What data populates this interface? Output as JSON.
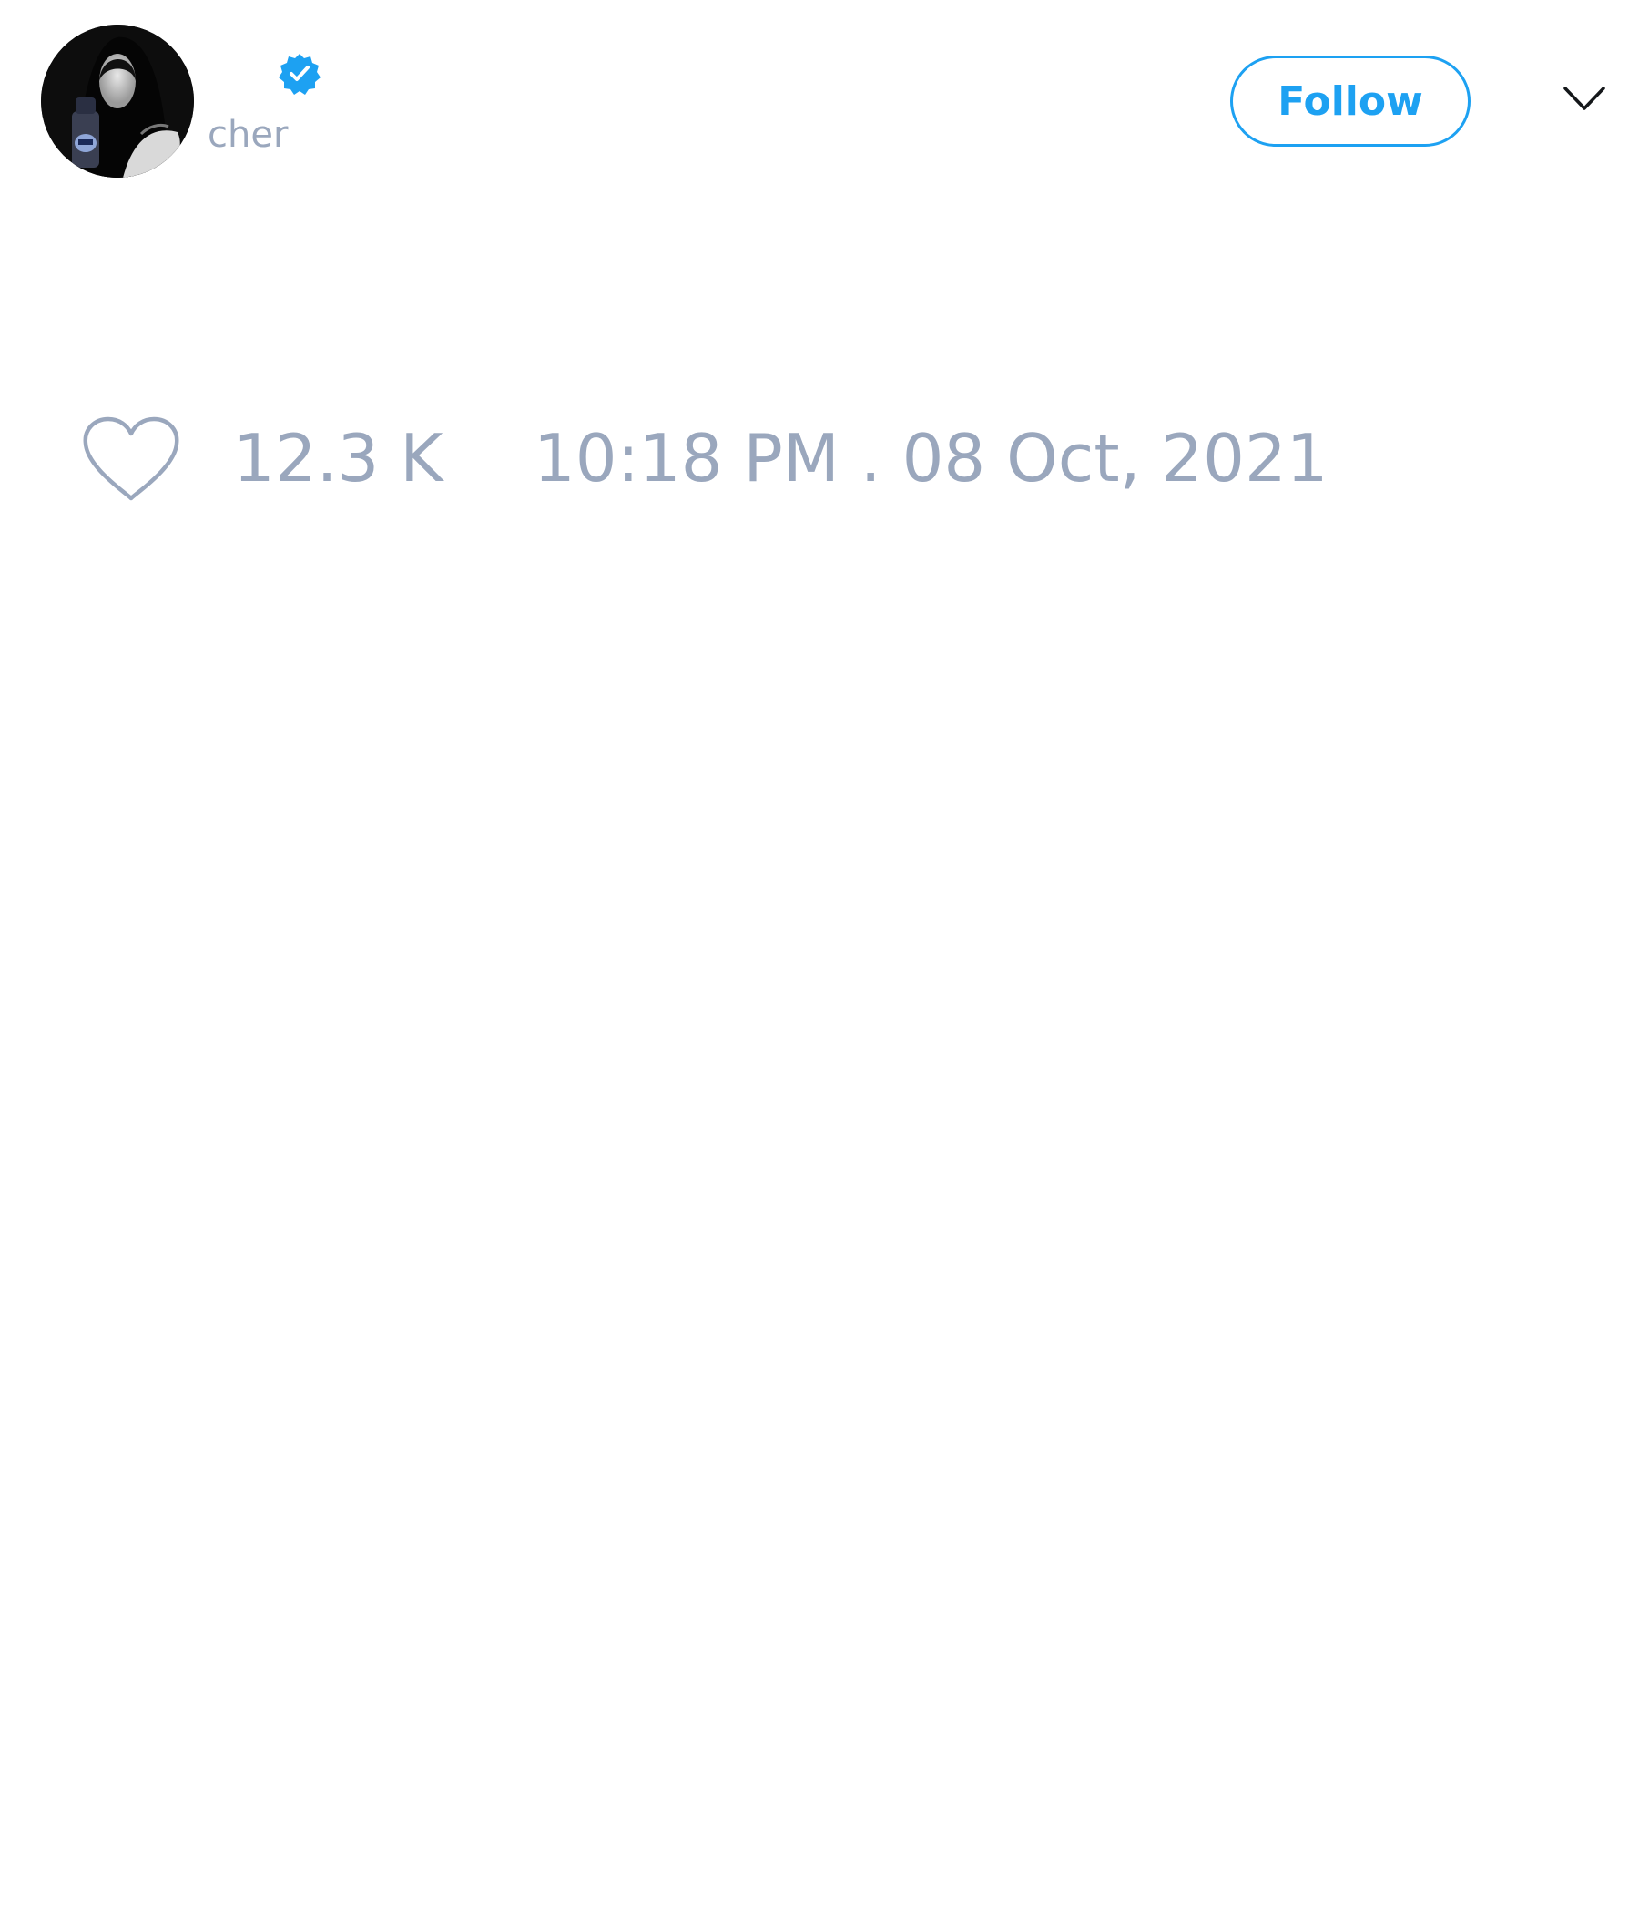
{
  "author": {
    "display_name": "",
    "handle": "cher",
    "verified": true,
    "avatar": "profile-photo"
  },
  "header": {
    "follow_label": "Follow",
    "menu_icon": "chevron-down-icon"
  },
  "stats": {
    "like_icon": "heart-outline-icon",
    "likes": "12.3 K",
    "timestamp": "10:18 PM . 08 Oct, 2021"
  },
  "colors": {
    "accent": "#1da1f2",
    "muted_text": "#9aa7bd",
    "background": "#ffffff"
  }
}
